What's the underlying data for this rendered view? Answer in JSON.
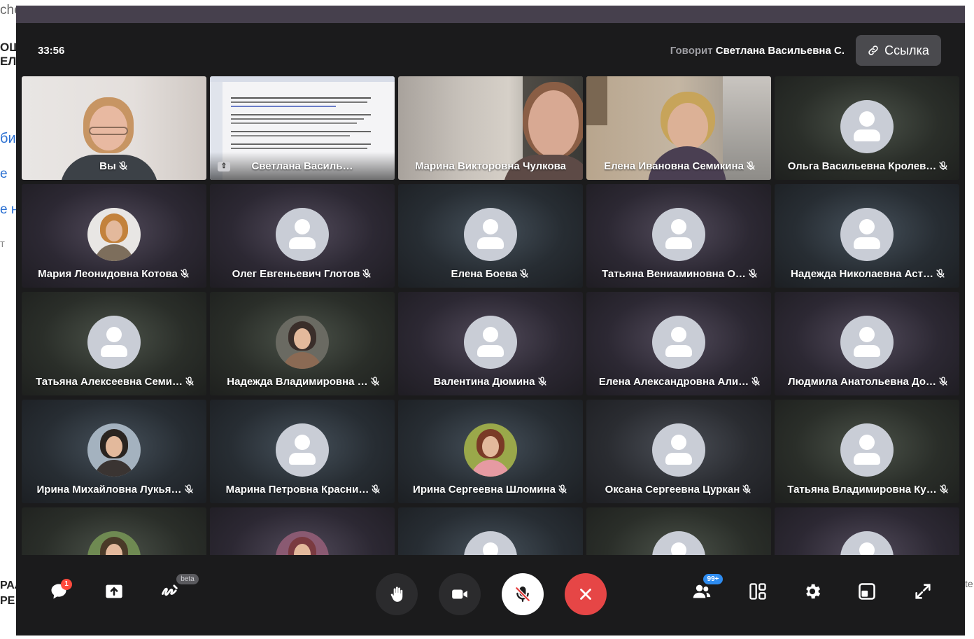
{
  "background": {
    "top_left": "che",
    "left_lines": [
      "ОЩ",
      "ЕЛЯ",
      "би",
      "е",
      "е н",
      "т"
    ],
    "bottom_left": [
      "РАЛ",
      "РЕ С"
    ],
    "right_fragment": "te"
  },
  "header": {
    "timer": "33:56",
    "speaking_label": "Говорит",
    "speaking_name": "Светлана Васильевна С.",
    "link_button": "Ссылка"
  },
  "participants": [
    {
      "name": "Вы",
      "kind": "video",
      "muted": true
    },
    {
      "name": "Светлана Васильевна С.",
      "display": "Светлана Василь…",
      "kind": "screen",
      "muted": false
    },
    {
      "name": "Марина Викторовна Чулкова",
      "kind": "video",
      "muted": false
    },
    {
      "name": "Елена Ивановна Семикина",
      "kind": "video",
      "muted": true
    },
    {
      "name": "Ольга Васильевна Кролев…",
      "kind": "avatar",
      "muted": true
    },
    {
      "name": "Мария Леонидовна Котова",
      "kind": "photo",
      "muted": true
    },
    {
      "name": "Олег Евгеньевич Глотов",
      "kind": "avatar",
      "muted": true
    },
    {
      "name": "Елена Боева",
      "kind": "avatar",
      "muted": true
    },
    {
      "name": "Татьяна Вениаминовна О…",
      "kind": "avatar",
      "muted": true
    },
    {
      "name": "Надежда Николаевна Аст…",
      "kind": "avatar",
      "muted": true
    },
    {
      "name": "Татьяна Алексеевна Семи…",
      "kind": "avatar",
      "muted": true
    },
    {
      "name": "Надежда Владимировна …",
      "kind": "photo",
      "muted": true
    },
    {
      "name": "Валентина Дюмина",
      "kind": "avatar",
      "muted": true
    },
    {
      "name": "Елена Александровна Али…",
      "kind": "avatar",
      "muted": true
    },
    {
      "name": "Людмила Анатольевна До…",
      "kind": "avatar",
      "muted": true
    },
    {
      "name": "Ирина Михайловна Лукья…",
      "kind": "photo",
      "muted": true
    },
    {
      "name": "Марина Петровна Красни…",
      "kind": "avatar",
      "muted": true
    },
    {
      "name": "Ирина Сергеевна Шломина",
      "kind": "photo",
      "muted": true
    },
    {
      "name": "Оксана Сергеевна Цуркан",
      "kind": "avatar",
      "muted": true
    },
    {
      "name": "Татьяна Владимировна Ку…",
      "kind": "avatar",
      "muted": true
    }
  ],
  "toolbar": {
    "chat_badge": "1",
    "beta_badge": "beta",
    "participants_badge": "99+",
    "icons": [
      "chat-icon",
      "share-screen-icon",
      "whiteboard-icon",
      "raise-hand-icon",
      "camera-icon",
      "microphone-off-icon",
      "end-call-icon",
      "participants-icon",
      "layout-icon",
      "settings-icon",
      "picture-in-picture-icon",
      "fullscreen-icon"
    ]
  },
  "colors": {
    "window_bg": "#1b1b1c",
    "title_bar": "#46404d",
    "end_call": "#e64646",
    "badge_blue": "#2e8cf0",
    "badge_red": "#ff4a3d"
  }
}
